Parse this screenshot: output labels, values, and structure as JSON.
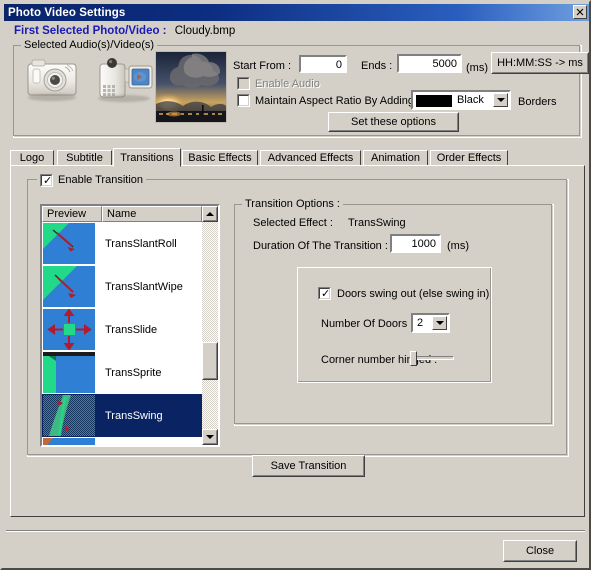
{
  "window": {
    "title": "Photo Video Settings",
    "close_glyph": "✕"
  },
  "header": {
    "label": "First Selected Photo/Video :",
    "filename": "Cloudy.bmp"
  },
  "audio_video_group": {
    "legend": "Selected Audio(s)/Video(s)",
    "start_from_label": "Start From :",
    "start_from_value": "0",
    "ends_label": "Ends :",
    "ends_value": "5000",
    "ms_unit": "(ms)",
    "convert_button": "HH:MM:SS -> ms",
    "enable_audio_label": "Enable Audio",
    "enable_audio_checked": false,
    "enable_audio_disabled": true,
    "maintain_aspect_label": "Maintain Aspect Ratio By Adding",
    "maintain_aspect_checked": false,
    "border_color_value": "Black",
    "border_color_hex": "#000000",
    "borders_label": "Borders",
    "set_options_button": "Set these options",
    "camera_icon": "camera-icon",
    "camcorder_icon": "camcorder-icon",
    "thumbnail_name": "photo-thumbnail"
  },
  "tabs": [
    {
      "label": "Logo",
      "selected": false
    },
    {
      "label": "Subtitle",
      "selected": false
    },
    {
      "label": "Transitions",
      "selected": true
    },
    {
      "label": "Basic Effects",
      "selected": false
    },
    {
      "label": "Advanced Effects",
      "selected": false
    },
    {
      "label": "Animation",
      "selected": false
    },
    {
      "label": "Order Effects",
      "selected": false
    }
  ],
  "transitions_tab": {
    "enable_transition_label": "Enable Transition",
    "enable_transition_checked": true,
    "list": {
      "col_preview": "Preview",
      "col_name": "Name",
      "rows": [
        {
          "name": "TransSlantRoll",
          "selected": false,
          "preview": "slant-roll-preview"
        },
        {
          "name": "TransSlantWipe",
          "selected": false,
          "preview": "slant-wipe-preview"
        },
        {
          "name": "TransSlide",
          "selected": false,
          "preview": "slide-preview"
        },
        {
          "name": "TransSprite",
          "selected": false,
          "preview": "sprite-preview"
        },
        {
          "name": "TransSwing",
          "selected": true,
          "preview": "swing-preview"
        }
      ],
      "scroll_up_glyph": "▲",
      "scroll_down_glyph": "▼"
    },
    "options": {
      "legend": "Transition Options :",
      "selected_effect_label": "Selected Effect :",
      "selected_effect_value": "TransSwing",
      "duration_label": "Duration Of The Transition :",
      "duration_value": "1000",
      "duration_unit": "(ms)",
      "doors_swing_label": "Doors swing out (else swing in)",
      "doors_swing_checked": true,
      "number_of_doors_label": "Number Of Doors :",
      "number_of_doors_value": "2",
      "corner_hinged_label": "Corner number hinged :",
      "corner_hinged_position": 0
    },
    "save_button": "Save Transition"
  },
  "footer": {
    "close_button": "Close"
  },
  "colors": {
    "face": "#d4d0c8",
    "title_start": "#0a246a",
    "title_end": "#6f9fe0",
    "header_accent": "#1a1ab4",
    "selection": "#0a2463",
    "preview_blue": "#2f7fd4",
    "preview_green": "#22d98a",
    "arrow_red": "#b01c2e"
  }
}
